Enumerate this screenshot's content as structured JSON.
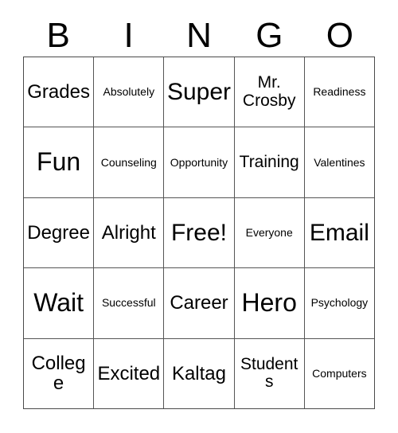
{
  "card": {
    "type": "bingo-card",
    "columns": 5,
    "rows": 5,
    "border_color": "#4a4a4a",
    "cell_background": "#ffffff",
    "text_color": "#000000"
  },
  "header": {
    "letters": [
      "B",
      "I",
      "N",
      "G",
      "O"
    ]
  },
  "grid": {
    "rows": [
      [
        {
          "text": "Grades",
          "size": "md"
        },
        {
          "text": "Absolutely",
          "size": "xxs"
        },
        {
          "text": "Super",
          "size": "lg"
        },
        {
          "text": "Mr. Crosby",
          "size": "sm"
        },
        {
          "text": "Readiness",
          "size": "xxs"
        }
      ],
      [
        {
          "text": "Fun",
          "size": "xl"
        },
        {
          "text": "Counseling",
          "size": "xxs"
        },
        {
          "text": "Opportunity",
          "size": "xxs"
        },
        {
          "text": "Training",
          "size": "sm"
        },
        {
          "text": "Valentines",
          "size": "xxs"
        }
      ],
      [
        {
          "text": "Degree",
          "size": "md"
        },
        {
          "text": "Alright",
          "size": "md"
        },
        {
          "text": "Free!",
          "size": "lg"
        },
        {
          "text": "Everyone",
          "size": "xxs"
        },
        {
          "text": "Email",
          "size": "lg"
        }
      ],
      [
        {
          "text": "Wait",
          "size": "xl"
        },
        {
          "text": "Successful",
          "size": "xxs"
        },
        {
          "text": "Career",
          "size": "md"
        },
        {
          "text": "Hero",
          "size": "xl"
        },
        {
          "text": "Psychology",
          "size": "xxs"
        }
      ],
      [
        {
          "text": "College",
          "size": "md"
        },
        {
          "text": "Excited",
          "size": "md"
        },
        {
          "text": "Kaltag",
          "size": "md"
        },
        {
          "text": "Students",
          "size": "sm"
        },
        {
          "text": "Computers",
          "size": "xxs"
        }
      ]
    ]
  }
}
